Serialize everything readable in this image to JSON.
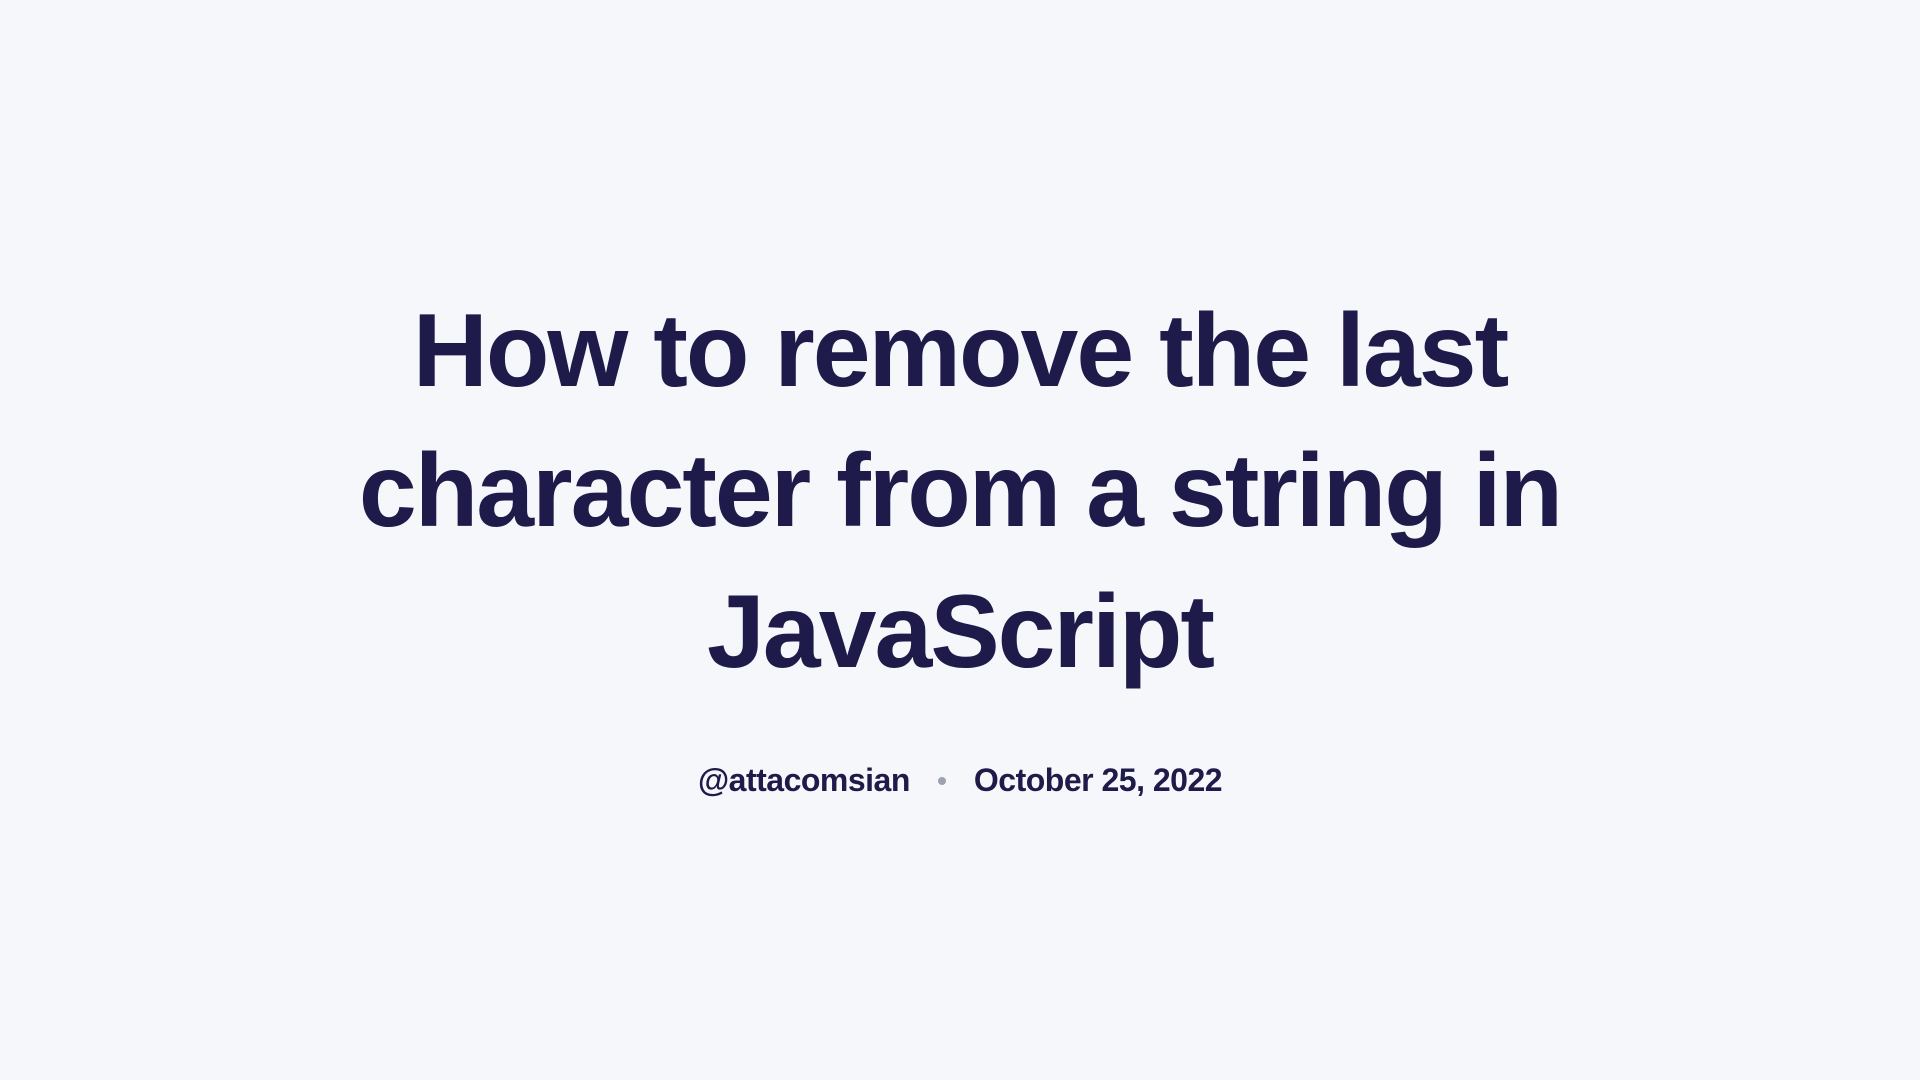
{
  "title": "How to remove the last character from a string in JavaScript",
  "author": "@attacomsian",
  "date": "October 25, 2022"
}
